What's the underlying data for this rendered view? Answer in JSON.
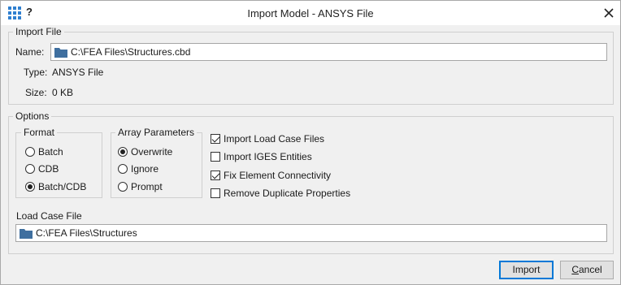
{
  "window": {
    "title": "Import Model - ANSYS File",
    "help_label": "?"
  },
  "import_file": {
    "group_label": "Import File",
    "name_label": "Name:",
    "name_value": "C:\\FEA Files\\Structures.cbd",
    "type_label": "Type:",
    "type_value": "ANSYS File",
    "size_label": "Size:",
    "size_value": "0 KB"
  },
  "options": {
    "group_label": "Options",
    "format": {
      "label": "Format",
      "items": [
        "Batch",
        "CDB",
        "Batch/CDB"
      ],
      "selected": "Batch/CDB"
    },
    "array_parameters": {
      "label": "Array Parameters",
      "items": [
        "Overwrite",
        "Ignore",
        "Prompt"
      ],
      "selected": "Overwrite"
    },
    "checkboxes": [
      {
        "label": "Import Load Case Files",
        "checked": true
      },
      {
        "label": "Import IGES Entities",
        "checked": false
      },
      {
        "label": "Fix Element Connectivity",
        "checked": true
      },
      {
        "label": "Remove Duplicate Properties",
        "checked": false
      }
    ],
    "load_case_label": "Load Case File",
    "load_case_value": "C:\\FEA Files\\Structures"
  },
  "buttons": {
    "import": "Import",
    "cancel_first": "C",
    "cancel_rest": "ancel"
  },
  "colors": {
    "accent": "#0078d7",
    "folder": "#3f6f9f"
  }
}
